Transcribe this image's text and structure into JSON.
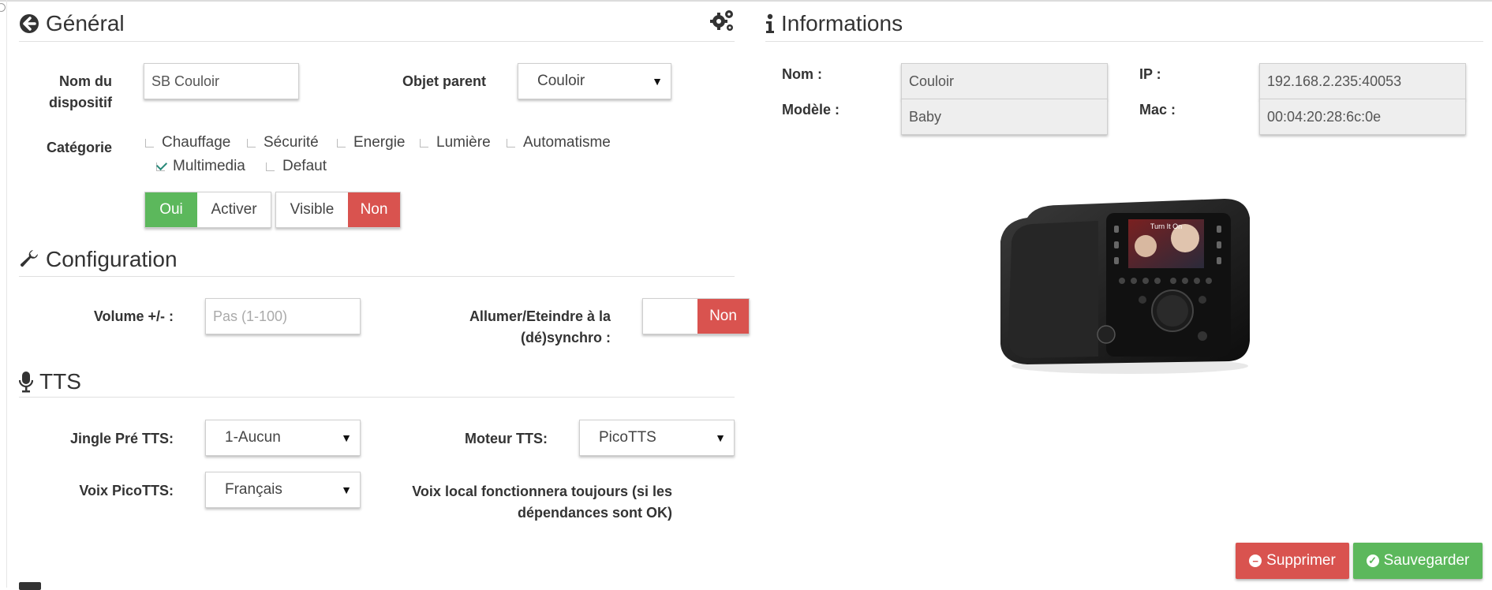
{
  "general": {
    "title": "Général",
    "nom_label": "Nom du dispositif",
    "nom_value": "SB Couloir",
    "objet_label": "Objet parent",
    "objet_value": "Couloir",
    "categorie_label": "Catégorie",
    "categories": [
      {
        "label": "Chauffage",
        "checked": false
      },
      {
        "label": "Sécurité",
        "checked": false
      },
      {
        "label": "Energie",
        "checked": false
      },
      {
        "label": "Lumière",
        "checked": false
      },
      {
        "label": "Automatisme",
        "checked": false
      },
      {
        "label": "Multimedia",
        "checked": true
      },
      {
        "label": "Defaut",
        "checked": false
      }
    ],
    "activer_state": "Oui",
    "activer_label": "Activer",
    "visible_label": "Visible",
    "visible_state": "Non"
  },
  "configuration": {
    "title": "Configuration",
    "volume_label": "Volume +/- :",
    "volume_placeholder": "Pas (1-100)",
    "sync_label": "Allumer/Eteindre à la (dé)synchro :",
    "sync_state": "Non"
  },
  "tts": {
    "title": "TTS",
    "jingle_label": "Jingle Pré TTS:",
    "jingle_value": "1-Aucun",
    "moteur_label": "Moteur TTS:",
    "moteur_value": "PicoTTS",
    "voix_label": "Voix PicoTTS:",
    "voix_value": "Français",
    "voix_note": "Voix local fonctionnera toujours (si les dépendances sont OK)"
  },
  "informations": {
    "title": "Informations",
    "nom_label": "Nom :",
    "nom_value": "Couloir",
    "ip_label": "IP :",
    "ip_value": "192.168.2.235:40053",
    "modele_label": "Modèle :",
    "modele_value": "Baby",
    "mac_label": "Mac :",
    "mac_value": "00:04:20:28:6c:0e",
    "device_screen_text": "Turn It On"
  },
  "actions": {
    "delete_label": "Supprimer",
    "save_label": "Sauvegarder"
  },
  "icons": [
    "arrow-circle-left-icon",
    "gears-icon",
    "info-icon",
    "wrench-icon",
    "microphone-icon",
    "minus-circle-icon",
    "check-circle-icon"
  ],
  "colors": {
    "green": "#5cb85c",
    "red": "#d9534f"
  }
}
